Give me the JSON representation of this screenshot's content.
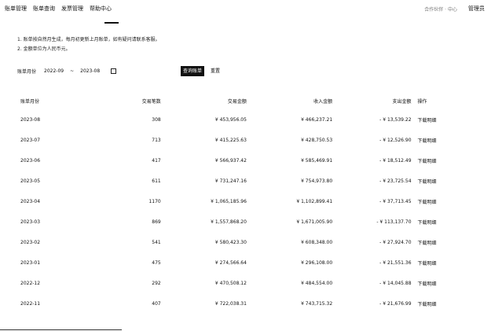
{
  "nav": {
    "items": [
      "账单管理",
      "账单查询",
      "发票管理",
      "帮助中心"
    ]
  },
  "header": {
    "right_muted": "合作伙伴 · 中心",
    "user": "管理员"
  },
  "notes": [
    "1. 账单按自然月生成，每月初更新上月账单，如有疑问请联系客服。",
    "2. 金额单位为人民币元。"
  ],
  "filter": {
    "label": "账单月份",
    "start": "2022-09",
    "sep": "~",
    "end": "2023-08",
    "query_label": "查询账单",
    "reset_label": "重置"
  },
  "table": {
    "headers": [
      "账单月份",
      "交易笔数",
      "交易金额",
      "收入金额",
      "支出金额",
      "操作"
    ],
    "rows": [
      {
        "month": "2023-08",
        "count": "308",
        "amount": "¥ 453,956.05",
        "income": "¥ 466,237.21",
        "expense": "- ¥ 13,539.22",
        "action": "下载明细"
      },
      {
        "month": "2023-07",
        "count": "713",
        "amount": "¥ 415,225.63",
        "income": "¥ 428,750.53",
        "expense": "- ¥ 12,526.90",
        "action": "下载明细"
      },
      {
        "month": "2023-06",
        "count": "417",
        "amount": "¥ 566,937.42",
        "income": "¥ 585,469.91",
        "expense": "- ¥ 18,512.49",
        "action": "下载明细"
      },
      {
        "month": "2023-05",
        "count": "611",
        "amount": "¥ 731,247.16",
        "income": "¥ 754,973.80",
        "expense": "- ¥ 23,725.54",
        "action": "下载明细"
      },
      {
        "month": "2023-04",
        "count": "1170",
        "amount": "¥ 1,065,185.96",
        "income": "¥ 1,102,899.41",
        "expense": "- ¥ 37,713.45",
        "action": "下载明细"
      },
      {
        "month": "2023-03",
        "count": "869",
        "amount": "¥ 1,557,868.20",
        "income": "¥ 1,671,005.90",
        "expense": "- ¥ 113,137.70",
        "action": "下载明细"
      },
      {
        "month": "2023-02",
        "count": "541",
        "amount": "¥ 580,423.30",
        "income": "¥ 608,348.00",
        "expense": "- ¥ 27,924.70",
        "action": "下载明细"
      },
      {
        "month": "2023-01",
        "count": "475",
        "amount": "¥ 274,566.64",
        "income": "¥ 296,108.00",
        "expense": "- ¥ 21,551.36",
        "action": "下载明细"
      },
      {
        "month": "2022-12",
        "count": "292",
        "amount": "¥ 470,508.12",
        "income": "¥ 484,554.00",
        "expense": "- ¥ 14,045.88",
        "action": "下载明细"
      },
      {
        "month": "2022-11",
        "count": "407",
        "amount": "¥ 722,038.31",
        "income": "¥ 743,715.32",
        "expense": "- ¥ 21,676.99",
        "action": "下载明细"
      }
    ]
  }
}
